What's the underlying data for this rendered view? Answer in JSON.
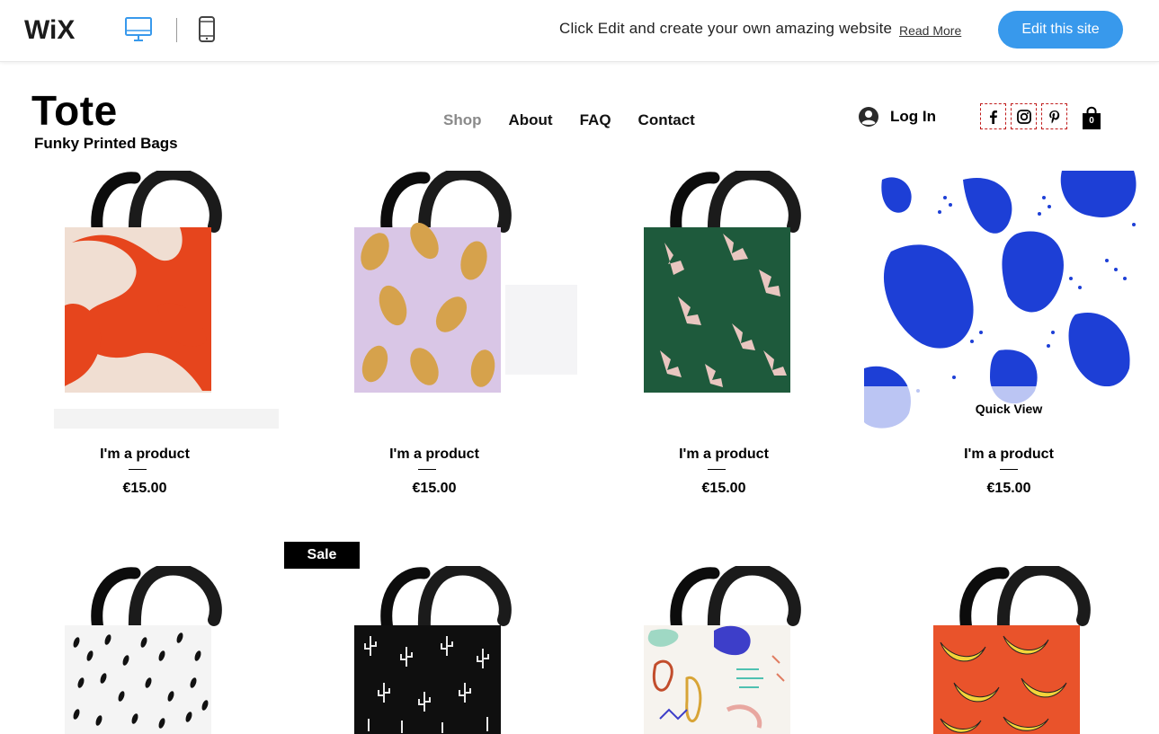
{
  "wix_bar": {
    "logo_text": "WiX",
    "promo_text": "Click Edit and create your own amazing website",
    "read_more_label": "Read More",
    "edit_button_label": "Edit this site",
    "accent": "#3899ec"
  },
  "site": {
    "title": "Tote",
    "tagline": "Funky Printed Bags"
  },
  "nav": {
    "items": [
      {
        "label": "Shop",
        "active": true
      },
      {
        "label": "About",
        "active": false
      },
      {
        "label": "FAQ",
        "active": false
      },
      {
        "label": "Contact",
        "active": false
      }
    ]
  },
  "header": {
    "login_label": "Log In",
    "social_icons": [
      "facebook-icon",
      "instagram-icon",
      "pinterest-icon"
    ],
    "cart_count": "0"
  },
  "products": {
    "quick_view_label": "Quick View",
    "sale_label": "Sale",
    "items": [
      {
        "name": "I'm a product",
        "price": "€15.00",
        "pattern": "orange-brush"
      },
      {
        "name": "I'm a product",
        "price": "€15.00",
        "pattern": "lemons"
      },
      {
        "name": "I'm a product",
        "price": "€15.00",
        "pattern": "green-hands"
      },
      {
        "name": "I'm a product",
        "price": "€15.00",
        "pattern": "blue-blobs"
      },
      {
        "name": "",
        "price": "",
        "pattern": "dots"
      },
      {
        "name": "",
        "price": "",
        "pattern": "cactus"
      },
      {
        "name": "",
        "price": "",
        "pattern": "abstract"
      },
      {
        "name": "",
        "price": "",
        "pattern": "bananas"
      }
    ]
  }
}
